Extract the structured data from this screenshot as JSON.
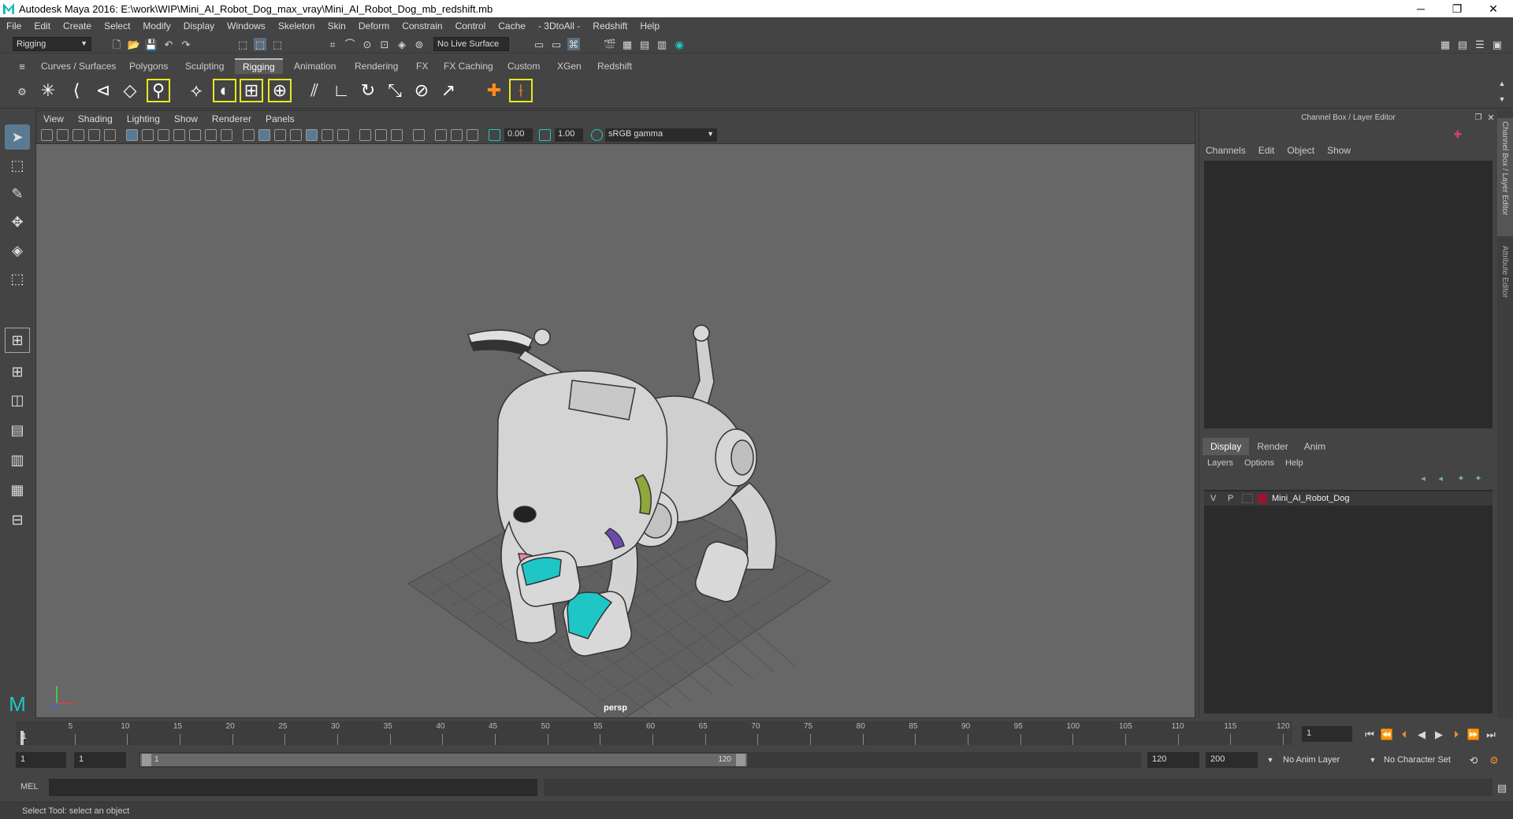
{
  "window": {
    "title": "Autodesk Maya 2016: E:\\work\\WIP\\Mini_AI_Robot_Dog_max_vray\\Mini_AI_Robot_Dog_mb_redshift.mb"
  },
  "menubar": [
    "File",
    "Edit",
    "Create",
    "Select",
    "Modify",
    "Display",
    "Windows",
    "Skeleton",
    "Skin",
    "Deform",
    "Constrain",
    "Control",
    "Cache",
    "- 3DtoAll -",
    "Redshift",
    "Help"
  ],
  "status_line": {
    "menu_set": "Rigging",
    "live_surface": "No Live Surface"
  },
  "shelf_tabs": [
    "Curves / Surfaces",
    "Polygons",
    "Sculpting",
    "Rigging",
    "Animation",
    "Rendering",
    "FX",
    "FX Caching",
    "Custom",
    "XGen",
    "Redshift"
  ],
  "shelf_active_tab": "Rigging",
  "viewport": {
    "menu": [
      "View",
      "Shading",
      "Lighting",
      "Show",
      "Renderer",
      "Panels"
    ],
    "exposure": "0.00",
    "gamma": "1.00",
    "color_space": "sRGB gamma",
    "camera_label": "persp"
  },
  "channel_box": {
    "title": "Channel Box / Layer Editor",
    "menu": [
      "Channels",
      "Edit",
      "Object",
      "Show"
    ]
  },
  "layer_editor": {
    "tabs": [
      "Display",
      "Render",
      "Anim"
    ],
    "active_tab": "Display",
    "menu": [
      "Layers",
      "Options",
      "Help"
    ],
    "layers": [
      {
        "visible": "V",
        "playback": "P",
        "name": "Mini_AI_Robot_Dog",
        "color": "#9b1530"
      }
    ]
  },
  "side_tabs": [
    "Channel Box / Layer Editor",
    "Attribute Editor"
  ],
  "time_slider": {
    "ticks": [
      "5",
      "10",
      "15",
      "20",
      "25",
      "30",
      "35",
      "40",
      "45",
      "50",
      "55",
      "60",
      "65",
      "70",
      "75",
      "80",
      "85",
      "90",
      "95",
      "100",
      "105",
      "110",
      "115",
      "120"
    ],
    "start_label": "1",
    "current_frame": "1"
  },
  "range_slider": {
    "start": "1",
    "playback_start": "1",
    "range_start_label": "1",
    "range_end_label": "120",
    "playback_end": "120",
    "end": "200",
    "anim_layer": "No Anim Layer",
    "character_set": "No Character Set"
  },
  "command_line": {
    "label": "MEL"
  },
  "help_line": {
    "text": "Select Tool: select an object"
  },
  "colors": {
    "accent": "#5a5a5a",
    "highlight_cyan": "#1ec6c6",
    "shelf_box": "#e8e820"
  }
}
